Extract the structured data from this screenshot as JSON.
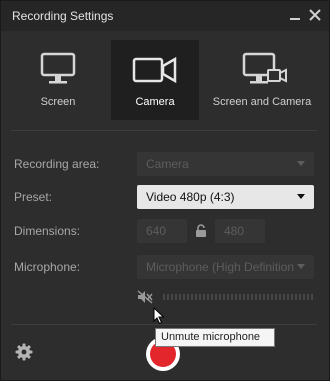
{
  "window": {
    "title": "Recording Settings",
    "minimize_icon": "minimize-icon",
    "close_icon": "close-icon"
  },
  "modes": [
    {
      "label": "Screen",
      "icon": "monitor-icon",
      "active": false
    },
    {
      "label": "Camera",
      "icon": "video-camera-icon",
      "active": true
    },
    {
      "label": "Screen and Camera",
      "icon": "monitor-camera-icon",
      "active": false
    }
  ],
  "form": {
    "recording_area": {
      "label": "Recording area:",
      "value": "Camera",
      "enabled": false
    },
    "preset": {
      "label": "Preset:",
      "value": "Video 480p (4:3)",
      "enabled": true
    },
    "dimensions": {
      "label": "Dimensions:",
      "width": "640",
      "height": "480",
      "lock_icon": "unlock-icon"
    },
    "microphone": {
      "label": "Microphone:",
      "value": "Microphone (High Definition Audio Device)",
      "enabled": false,
      "muted": true
    }
  },
  "tooltip": {
    "text": "Unmute microphone"
  },
  "footer": {
    "settings_icon": "gear-icon",
    "record_icon": "record-icon"
  },
  "colors": {
    "background": "#2d2d2d",
    "record": "#e3262b",
    "active_tab": "#1f1f1f"
  }
}
